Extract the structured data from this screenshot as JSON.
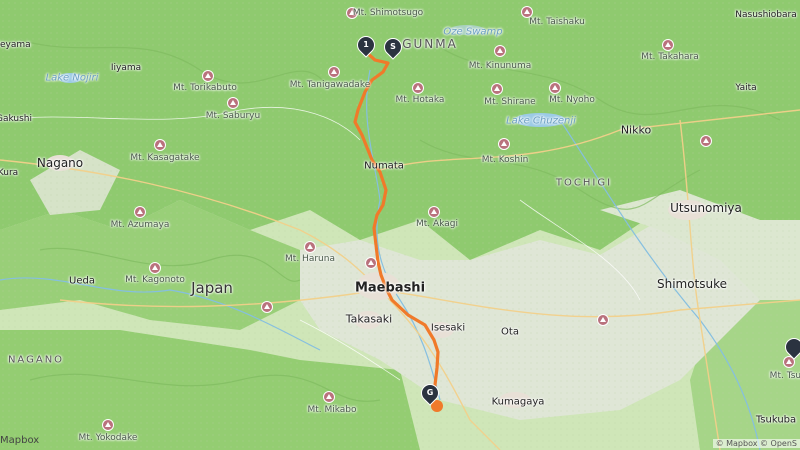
{
  "map": {
    "country_label": "Japan",
    "regions": [
      "GUNMA",
      "TOCHIGI",
      "NAGANO"
    ],
    "cities": [
      "Nagano",
      "Numata",
      "Maebashi",
      "Takasaki",
      "Isesaki",
      "Ota",
      "Kumagaya",
      "Nikko",
      "Utsunomiya",
      "Shimotsuke",
      "Ueda",
      "Tsukuba",
      "Iiyama",
      "Yaita",
      "Nasushiobara",
      "Ueyama",
      "Gakushi",
      "Kura"
    ],
    "peaks": [
      "Mt. Shimotsugo",
      "Mt. Taishaku",
      "Mt. Tanigawadake",
      "Mt. Kinunuma",
      "Mt. Takahara",
      "Mt. Torikabuto",
      "Mt. Hotaka",
      "Mt. Shirane",
      "Mt. Nyoho",
      "Mt. Saburyu",
      "Mt. Koshin",
      "Mt. Kasagatake",
      "Mt. Azumaya",
      "Mt. Akagi",
      "Mt. Haruna",
      "Mt. Kagonoto",
      "Mt. Mikabo",
      "Mt. Yokodake",
      "Mt. Tsuk"
    ],
    "water": [
      "Oze Swamp",
      "Lake Chuzenji",
      "Lake Nojiri"
    ],
    "markers": {
      "marker_1": "1",
      "marker_start": "S",
      "marker_goal": "G"
    },
    "route_color": "#f07a2a",
    "attribution_left": "Mapbox",
    "attribution_right": "© Mapbox © OpenS"
  }
}
